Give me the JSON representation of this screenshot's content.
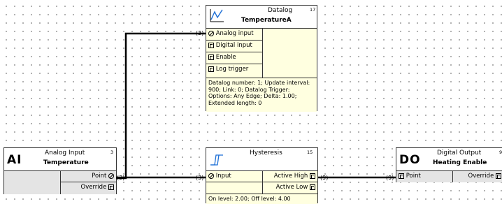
{
  "datalog": {
    "category": "Datalog",
    "number": "17",
    "name": "TemperatureA",
    "icon": "datalog-chart-icon",
    "inputs": [
      "Analog input",
      "Digital input",
      "Enable",
      "Log trigger"
    ],
    "description": "Datalog number: 1; Update interval: 900; Link: 0; Datalog Trigger: Options: Any Edge; Delta: 1.00; Extended length: 0",
    "fill": "#ffffe0"
  },
  "analog_input": {
    "mono": "AI",
    "category": "Analog Input",
    "number": "3",
    "name": "Temperature",
    "outputs": [
      "Point",
      "Override"
    ],
    "fill": "#e4e4e4"
  },
  "hysteresis": {
    "category": "Hysteresis",
    "number": "15",
    "icon": "hysteresis-icon",
    "input": "Input",
    "outputs": [
      "Active High",
      "Active Low"
    ],
    "description": "On level: 2.00; Off level: 4.00",
    "fill": "#ffffe0"
  },
  "digital_output": {
    "mono": "DO",
    "category": "Digital Output",
    "number": "9",
    "name": "Heating Enable",
    "input": "Point",
    "right_label": "Override"
  },
  "pins": {
    "ai_point": "(3)",
    "datalog_in": "(3)",
    "hyst_in": "(3)",
    "hyst_out": "(9)",
    "do_in": "(9)"
  },
  "colors": {
    "wire": "#000000",
    "grid_dot": "#8a8a8a"
  }
}
